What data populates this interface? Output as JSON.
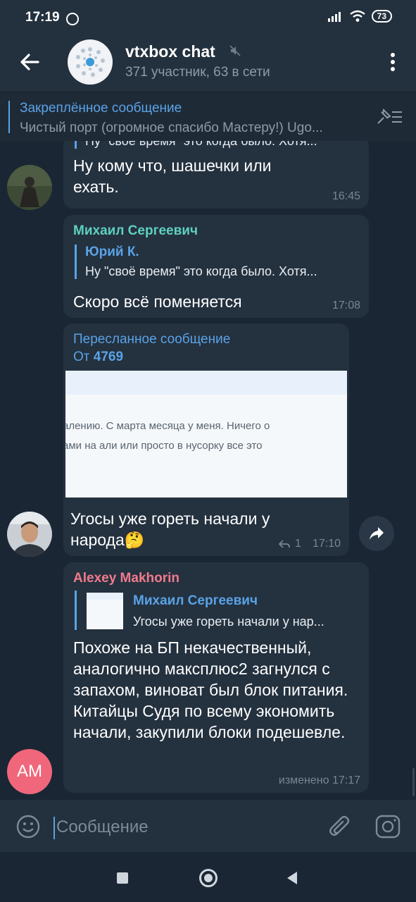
{
  "status_bar": {
    "time": "17:19",
    "battery": "73"
  },
  "header": {
    "title": "vtxbox chat",
    "subtitle": "371 участник, 63 в сети"
  },
  "pinned": {
    "title": "Закреплённое сообщение",
    "text": "Чистый порт (огромное спасибо Мастеру!) Ugo..."
  },
  "messages": [
    {
      "reply_text": "Ну \"своё время\" это когда было. Хотя...",
      "text": "Ну кому что, шашечки или ехать.",
      "time": "16:45"
    },
    {
      "sender": "Михаил Сергеевич",
      "reply_name": "Юрий К.",
      "reply_text": "Ну \"своё время\" это когда было. Хотя...",
      "text": "Скоро всё поменяется",
      "time": "17:08"
    },
    {
      "forward_label": "Пересланное сообщение",
      "forward_from_prefix": "От",
      "forward_from": "4769",
      "image_line1": "алению. С марта месяца у меня. Ничего о",
      "image_line2": "ами на али или просто в нусорку все это",
      "text": "Угосы уже гореть начали у народа",
      "emoji": "🤔",
      "replies_count": "1",
      "time": "17:10"
    },
    {
      "sender": "Alexey Makhorin",
      "reply_name": "Михаил Сергеевич",
      "reply_text": "Угосы уже гореть начали у нар...",
      "text": "Похоже на БП некачественный, аналогично максплюс2 загнулся с запахом, виноват был блок питания. Китайцы Судя по всему экономить начали, закупили блоки подешевле.",
      "time": "изменено 17:17",
      "avatar_initials": "AM"
    }
  ],
  "composer": {
    "placeholder": "Сообщение"
  },
  "colors": {
    "accent": "#5aa3e6",
    "name_green": "#5fd0c0",
    "name_pink": "#f07a8c",
    "bubble": "#24313f",
    "background": "#1a2634"
  }
}
